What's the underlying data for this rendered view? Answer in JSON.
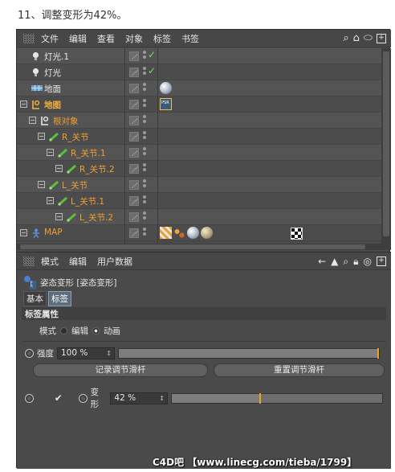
{
  "caption": "11、调整变形为42%。",
  "object_manager": {
    "menu": [
      "文件",
      "编辑",
      "查看",
      "对象",
      "标签",
      "书签"
    ],
    "objects": [
      {
        "name": "灯光.1",
        "style": "white",
        "indent": 0,
        "icon": "light-icon",
        "check": true,
        "tags": []
      },
      {
        "name": "灯光",
        "style": "white",
        "indent": 0,
        "icon": "light-icon",
        "check": true,
        "tags": []
      },
      {
        "name": "地面",
        "style": "white",
        "indent": 0,
        "icon": "floor-icon",
        "check": false,
        "tags": [
          "sphere"
        ]
      },
      {
        "name": "地图",
        "style": "sel",
        "indent": 0,
        "icon": "null-icon",
        "check": false,
        "tags": [
          "pose"
        ]
      },
      {
        "name": "根对象",
        "style": "orange",
        "indent": 1,
        "icon": "null-icon",
        "check": false,
        "tags": []
      },
      {
        "name": "R_关节",
        "style": "orange",
        "indent": 2,
        "icon": "joint-icon",
        "check": false,
        "tags": []
      },
      {
        "name": "R_关节.1",
        "style": "orange",
        "indent": 3,
        "icon": "joint-icon",
        "check": false,
        "tags": []
      },
      {
        "name": "R_关节.2",
        "style": "orange",
        "indent": 4,
        "icon": "joint-icon",
        "check": false,
        "tags": []
      },
      {
        "name": "L_关节",
        "style": "orange",
        "indent": 2,
        "icon": "joint-icon",
        "check": false,
        "tags": []
      },
      {
        "name": "L_关节.1",
        "style": "orange",
        "indent": 3,
        "icon": "joint-icon",
        "check": false,
        "tags": []
      },
      {
        "name": "L_关节.2",
        "style": "orange",
        "indent": 4,
        "icon": "joint-icon",
        "check": false,
        "tags": []
      },
      {
        "name": "MAP",
        "style": "orange",
        "indent": 0,
        "icon": "figure-icon",
        "check": false,
        "tags": [
          "flag",
          "dots2",
          "check",
          "sphere",
          "sphere2"
        ]
      }
    ]
  },
  "attribute_manager": {
    "menu": [
      "模式",
      "编辑",
      "用户数据"
    ],
    "object_title": "姿态变形 [姿态变形]",
    "tabs": [
      "基本",
      "标签"
    ],
    "active_tab": 1,
    "section_title": "标签属性",
    "mode_label": "模式",
    "mode_options": [
      "编辑",
      "动画"
    ],
    "mode_selected": 1,
    "strength_label": "强度",
    "strength_value": "100 %",
    "strength_fraction": 1.0,
    "record_button": "记录调节滑杆",
    "reset_button": "重置调节滑杆",
    "morph_label": "变形",
    "morph_value": "42 %",
    "morph_fraction": 0.42
  },
  "watermark": "C4D吧 【www.linecg.com/tieba/1799】",
  "colors": {
    "accent_orange": "#f0a030",
    "panel_bg": "#4a4a4a",
    "active_tab": "#5d6c7c"
  }
}
